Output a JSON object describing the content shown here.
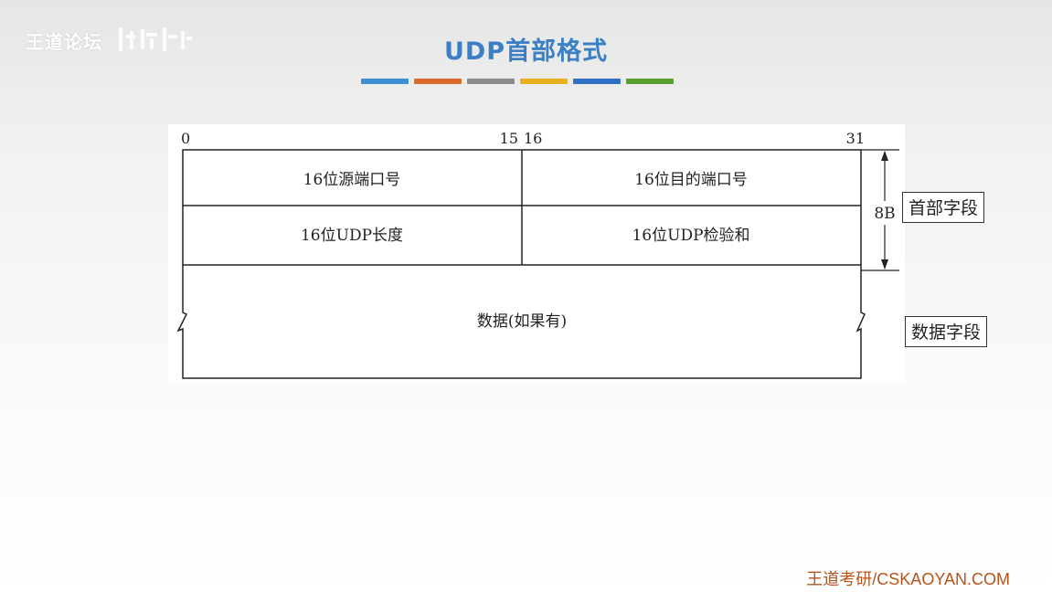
{
  "watermark": {
    "text": "王道论坛"
  },
  "title": "UDP首部格式",
  "color_bar": [
    "#3d8fd1",
    "#d9682b",
    "#8c8c8c",
    "#e8b020",
    "#2f6fc4",
    "#5a9e2e"
  ],
  "diagram": {
    "bit_labels": {
      "start": "0",
      "mid_left": "15",
      "mid_right": "16",
      "end": "31"
    },
    "fields": {
      "src_port": "16位源端口号",
      "dst_port": "16位目的端口号",
      "length": "16位UDP长度",
      "checksum": "16位UDP检验和",
      "data": "数据(如果有)"
    },
    "header_size": "8B",
    "header_label": "首部字段",
    "data_label": "数据字段"
  },
  "footer": "王道考研/CSKAOYAN.COM"
}
